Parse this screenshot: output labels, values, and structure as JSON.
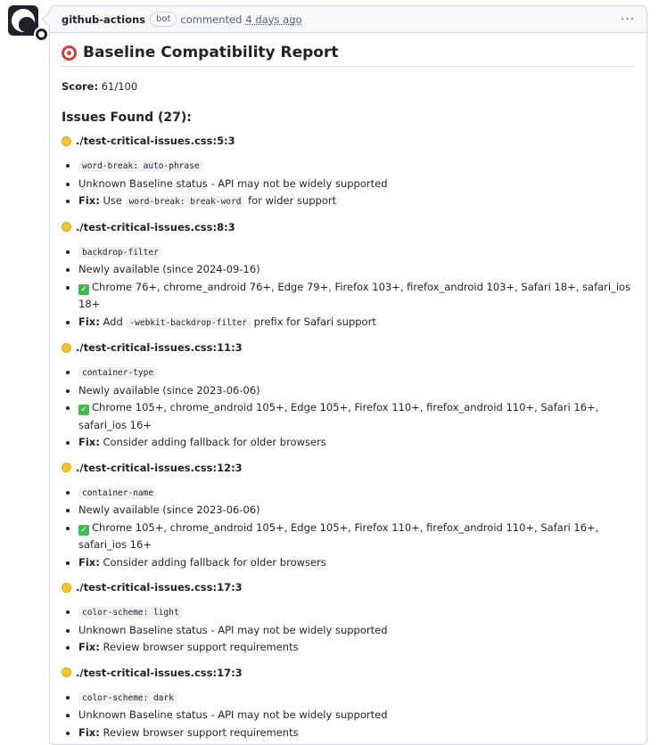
{
  "comment": {
    "author": "github-actions",
    "badge": "bot",
    "verb": "commented",
    "timestamp": "4 days ago",
    "menu_glyph": "···"
  },
  "report": {
    "title": "Baseline Compatibility Report",
    "score_label": "Score:",
    "score_value": "61/100",
    "issues_heading": "Issues Found (27):",
    "issues": [
      {
        "location": "./test-critical-issues.css:5:3",
        "property": "word-break: auto-phrase",
        "status": "Unknown Baseline status - API may not be widely supported",
        "fix_prefix": "Use",
        "fix_code": "word-break: break-word",
        "fix_suffix": "for wider support"
      },
      {
        "location": "./test-critical-issues.css:8:3",
        "property": "backdrop-filter",
        "status": "Newly available (since 2024-09-16)",
        "browsers": "Chrome 76+, chrome_android 76+, Edge 79+, Firefox 103+, firefox_android 103+, Safari 18+, safari_ios 18+",
        "fix_prefix": "Add",
        "fix_code": "-webkit-backdrop-filter",
        "fix_suffix": "prefix for Safari support"
      },
      {
        "location": "./test-critical-issues.css:11:3",
        "property": "container-type",
        "status": "Newly available (since 2023-06-06)",
        "browsers": "Chrome 105+, chrome_android 105+, Edge 105+, Firefox 110+, firefox_android 110+, Safari 16+, safari_ios 16+",
        "fix_text": "Consider adding fallback for older browsers"
      },
      {
        "location": "./test-critical-issues.css:12:3",
        "property": "container-name",
        "status": "Newly available (since 2023-06-06)",
        "browsers": "Chrome 105+, chrome_android 105+, Edge 105+, Firefox 110+, firefox_android 110+, Safari 16+, safari_ios 16+",
        "fix_text": "Consider adding fallback for older browsers"
      },
      {
        "location": "./test-critical-issues.css:17:3",
        "property": "color-scheme: light",
        "status": "Unknown Baseline status - API may not be widely supported",
        "fix_text": "Review browser support requirements"
      },
      {
        "location": "./test-critical-issues.css:17:3",
        "property": "color-scheme: dark",
        "status": "Unknown Baseline status - API may not be widely supported",
        "fix_text": "Review browser support requirements"
      }
    ],
    "fix_label": "Fix:"
  },
  "colors": {
    "border": "#d0d7de",
    "header_bg": "#f6f8fa",
    "warning_dot": "#f7c52b",
    "check_green": "#3fb950",
    "target_red": "#e5363a"
  },
  "icons": {
    "avatar": "github-actions-avatar",
    "title": "target-icon",
    "issue": "yellow-circle-icon",
    "supported": "check-mark-icon",
    "menu": "kebab-menu-icon"
  }
}
